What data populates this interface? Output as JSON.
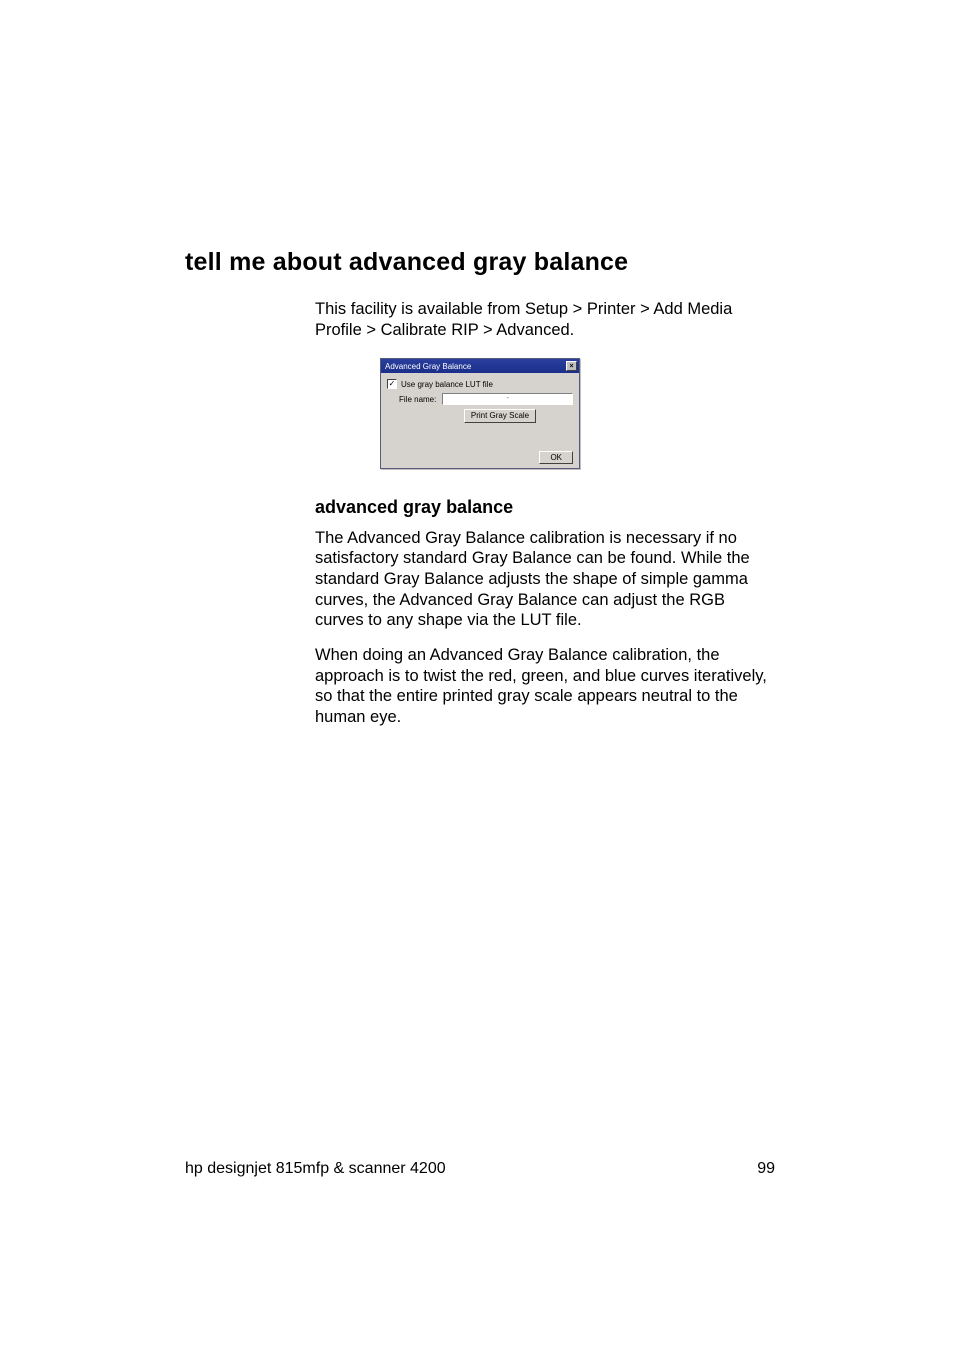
{
  "heading": "tell me about advanced gray balance",
  "intro": "This facility is available from Setup > Printer > Add Media Profile > Calibrate RIP > Advanced.",
  "dialog": {
    "title": "Advanced Gray Balance",
    "checkbox_label": "Use gray balance LUT file",
    "checkbox_checked": true,
    "filename_label": "File name:",
    "filename_value": "-",
    "print_button": "Print Gray Scale",
    "ok_button": "OK"
  },
  "sub_heading": "advanced gray balance",
  "para1": "The Advanced Gray Balance calibration is necessary if no satisfactory standard Gray Balance can be found. While the standard Gray Balance adjusts the shape of simple gamma curves, the Advanced Gray Balance can adjust the RGB curves to any shape via the LUT file.",
  "para2": "When doing an Advanced Gray Balance calibration, the approach is to twist the red, green, and blue curves iteratively, so that the entire printed gray scale appears neutral to the human eye.",
  "footer_left": "hp designjet 815mfp & scanner 4200",
  "footer_right": "99"
}
